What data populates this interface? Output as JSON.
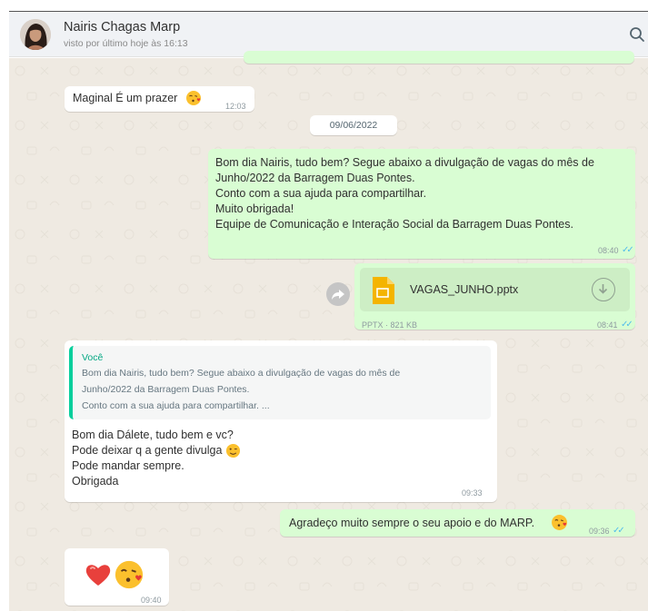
{
  "header": {
    "contact_name": "Nairis Chagas Marp",
    "status": "visto por último hoje às 16:13"
  },
  "messages": {
    "m1": {
      "text": "Maginal É um prazer",
      "time": "12:03",
      "emoji": "kiss-emoji"
    },
    "date_divider": "09/06/2022",
    "m2": {
      "lines": [
        "Bom dia Nairis, tudo bem? Segue abaixo a divulgação de vagas do mês de",
        "Junho/2022 da Barragem Duas Pontes.",
        "Conto com a sua ajuda para compartilhar.",
        "Muito obrigada!",
        "Equipe de Comunicação e Interação Social da Barragem Duas Pontes."
      ],
      "time": "08:40"
    },
    "m3": {
      "file_name": "VAGAS_JUNHO.pptx",
      "file_meta": "PPTX · 821 KB",
      "time": "08:41"
    },
    "m4": {
      "quote_author": "Você",
      "quote_lines": [
        "Bom dia Nairis, tudo bem? Segue abaixo a divulgação de vagas do mês de",
        "Junho/2022 da Barragem Duas Pontes.",
        "Conto com a sua ajuda para compartilhar. ..."
      ],
      "lines": [
        "Bom dia Dálete, tudo bem e vc?",
        "Pode deixar q a gente divulga",
        "Pode mandar sempre.",
        "Obrigada"
      ],
      "time": "09:33"
    },
    "m5": {
      "text": "Agradeço muito sempre o seu apoio e do MARP.",
      "time": "09:36",
      "emoji": "kiss-emoji"
    },
    "m6": {
      "emojis": [
        "heart-emoji",
        "kiss-emoji"
      ],
      "time": "09:40"
    }
  },
  "colors": {
    "incoming_bubble": "#ffffff",
    "outgoing_bubble": "#d9fdd3",
    "read_ticks": "#53bdeb",
    "chat_background": "#efeae2"
  }
}
